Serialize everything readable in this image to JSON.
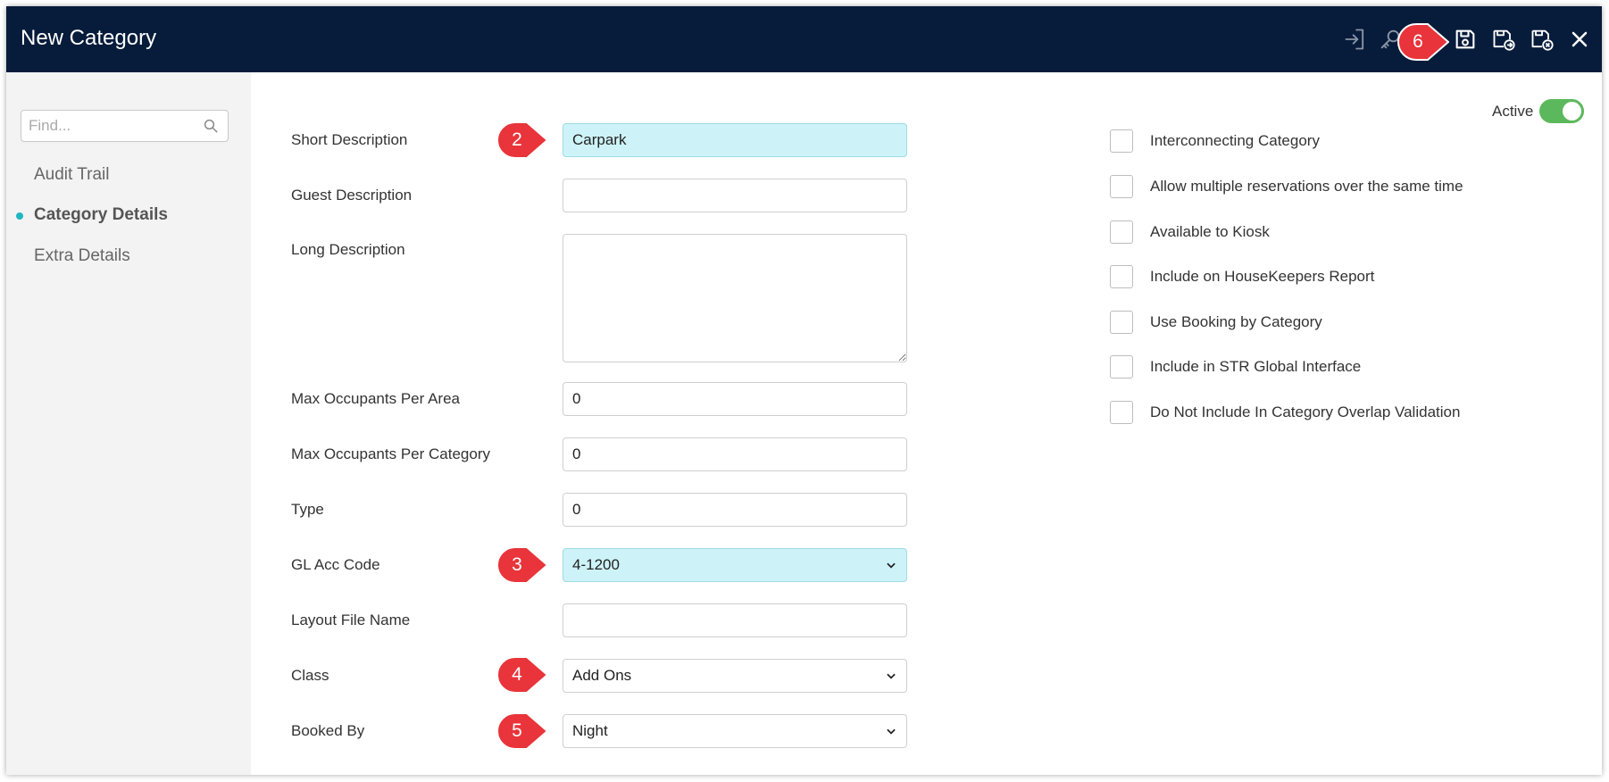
{
  "window": {
    "title": "New Category"
  },
  "toolbar": {
    "icons": [
      "import-icon",
      "key-icon",
      "save-icon",
      "save-and-new-icon",
      "save-and-close-icon",
      "close-icon"
    ],
    "callout": "6"
  },
  "sidebar": {
    "search_placeholder": "Find...",
    "items": [
      {
        "label": "Audit Trail",
        "active": false
      },
      {
        "label": "Category Details",
        "active": true
      },
      {
        "label": "Extra Details",
        "active": false
      }
    ]
  },
  "form": {
    "short_description": {
      "label": "Short Description",
      "value": "Carpark",
      "callout": "2"
    },
    "guest_description": {
      "label": "Guest Description",
      "value": ""
    },
    "long_description": {
      "label": "Long Description",
      "value": ""
    },
    "max_occupants_area": {
      "label": "Max Occupants Per Area",
      "value": "0"
    },
    "max_occupants_category": {
      "label": "Max Occupants Per Category",
      "value": "0"
    },
    "type": {
      "label": "Type",
      "value": "0"
    },
    "gl_acc_code": {
      "label": "GL Acc Code",
      "value": "4-1200",
      "callout": "3"
    },
    "layout_file_name": {
      "label": "Layout File Name",
      "value": ""
    },
    "class": {
      "label": "Class",
      "value": "Add Ons",
      "callout": "4"
    },
    "booked_by": {
      "label": "Booked By",
      "value": "Night",
      "callout": "5"
    }
  },
  "options": {
    "active_label": "Active",
    "active": true,
    "checkboxes": [
      {
        "label": "Interconnecting Category",
        "checked": false
      },
      {
        "label": "Allow multiple reservations over the same time",
        "checked": false
      },
      {
        "label": "Available to Kiosk",
        "checked": false
      },
      {
        "label": "Include on HouseKeepers Report",
        "checked": false
      },
      {
        "label": "Use Booking by Category",
        "checked": false
      },
      {
        "label": "Include in STR Global Interface",
        "checked": false
      },
      {
        "label": "Do Not Include In Category Overlap Validation",
        "checked": false
      }
    ]
  },
  "colors": {
    "header_bg": "#071c3b",
    "highlight_field": "#cdf3f8",
    "callout": "#e8343a",
    "toggle_on": "#5cb85c",
    "nav_dot": "#1fb6c1"
  }
}
